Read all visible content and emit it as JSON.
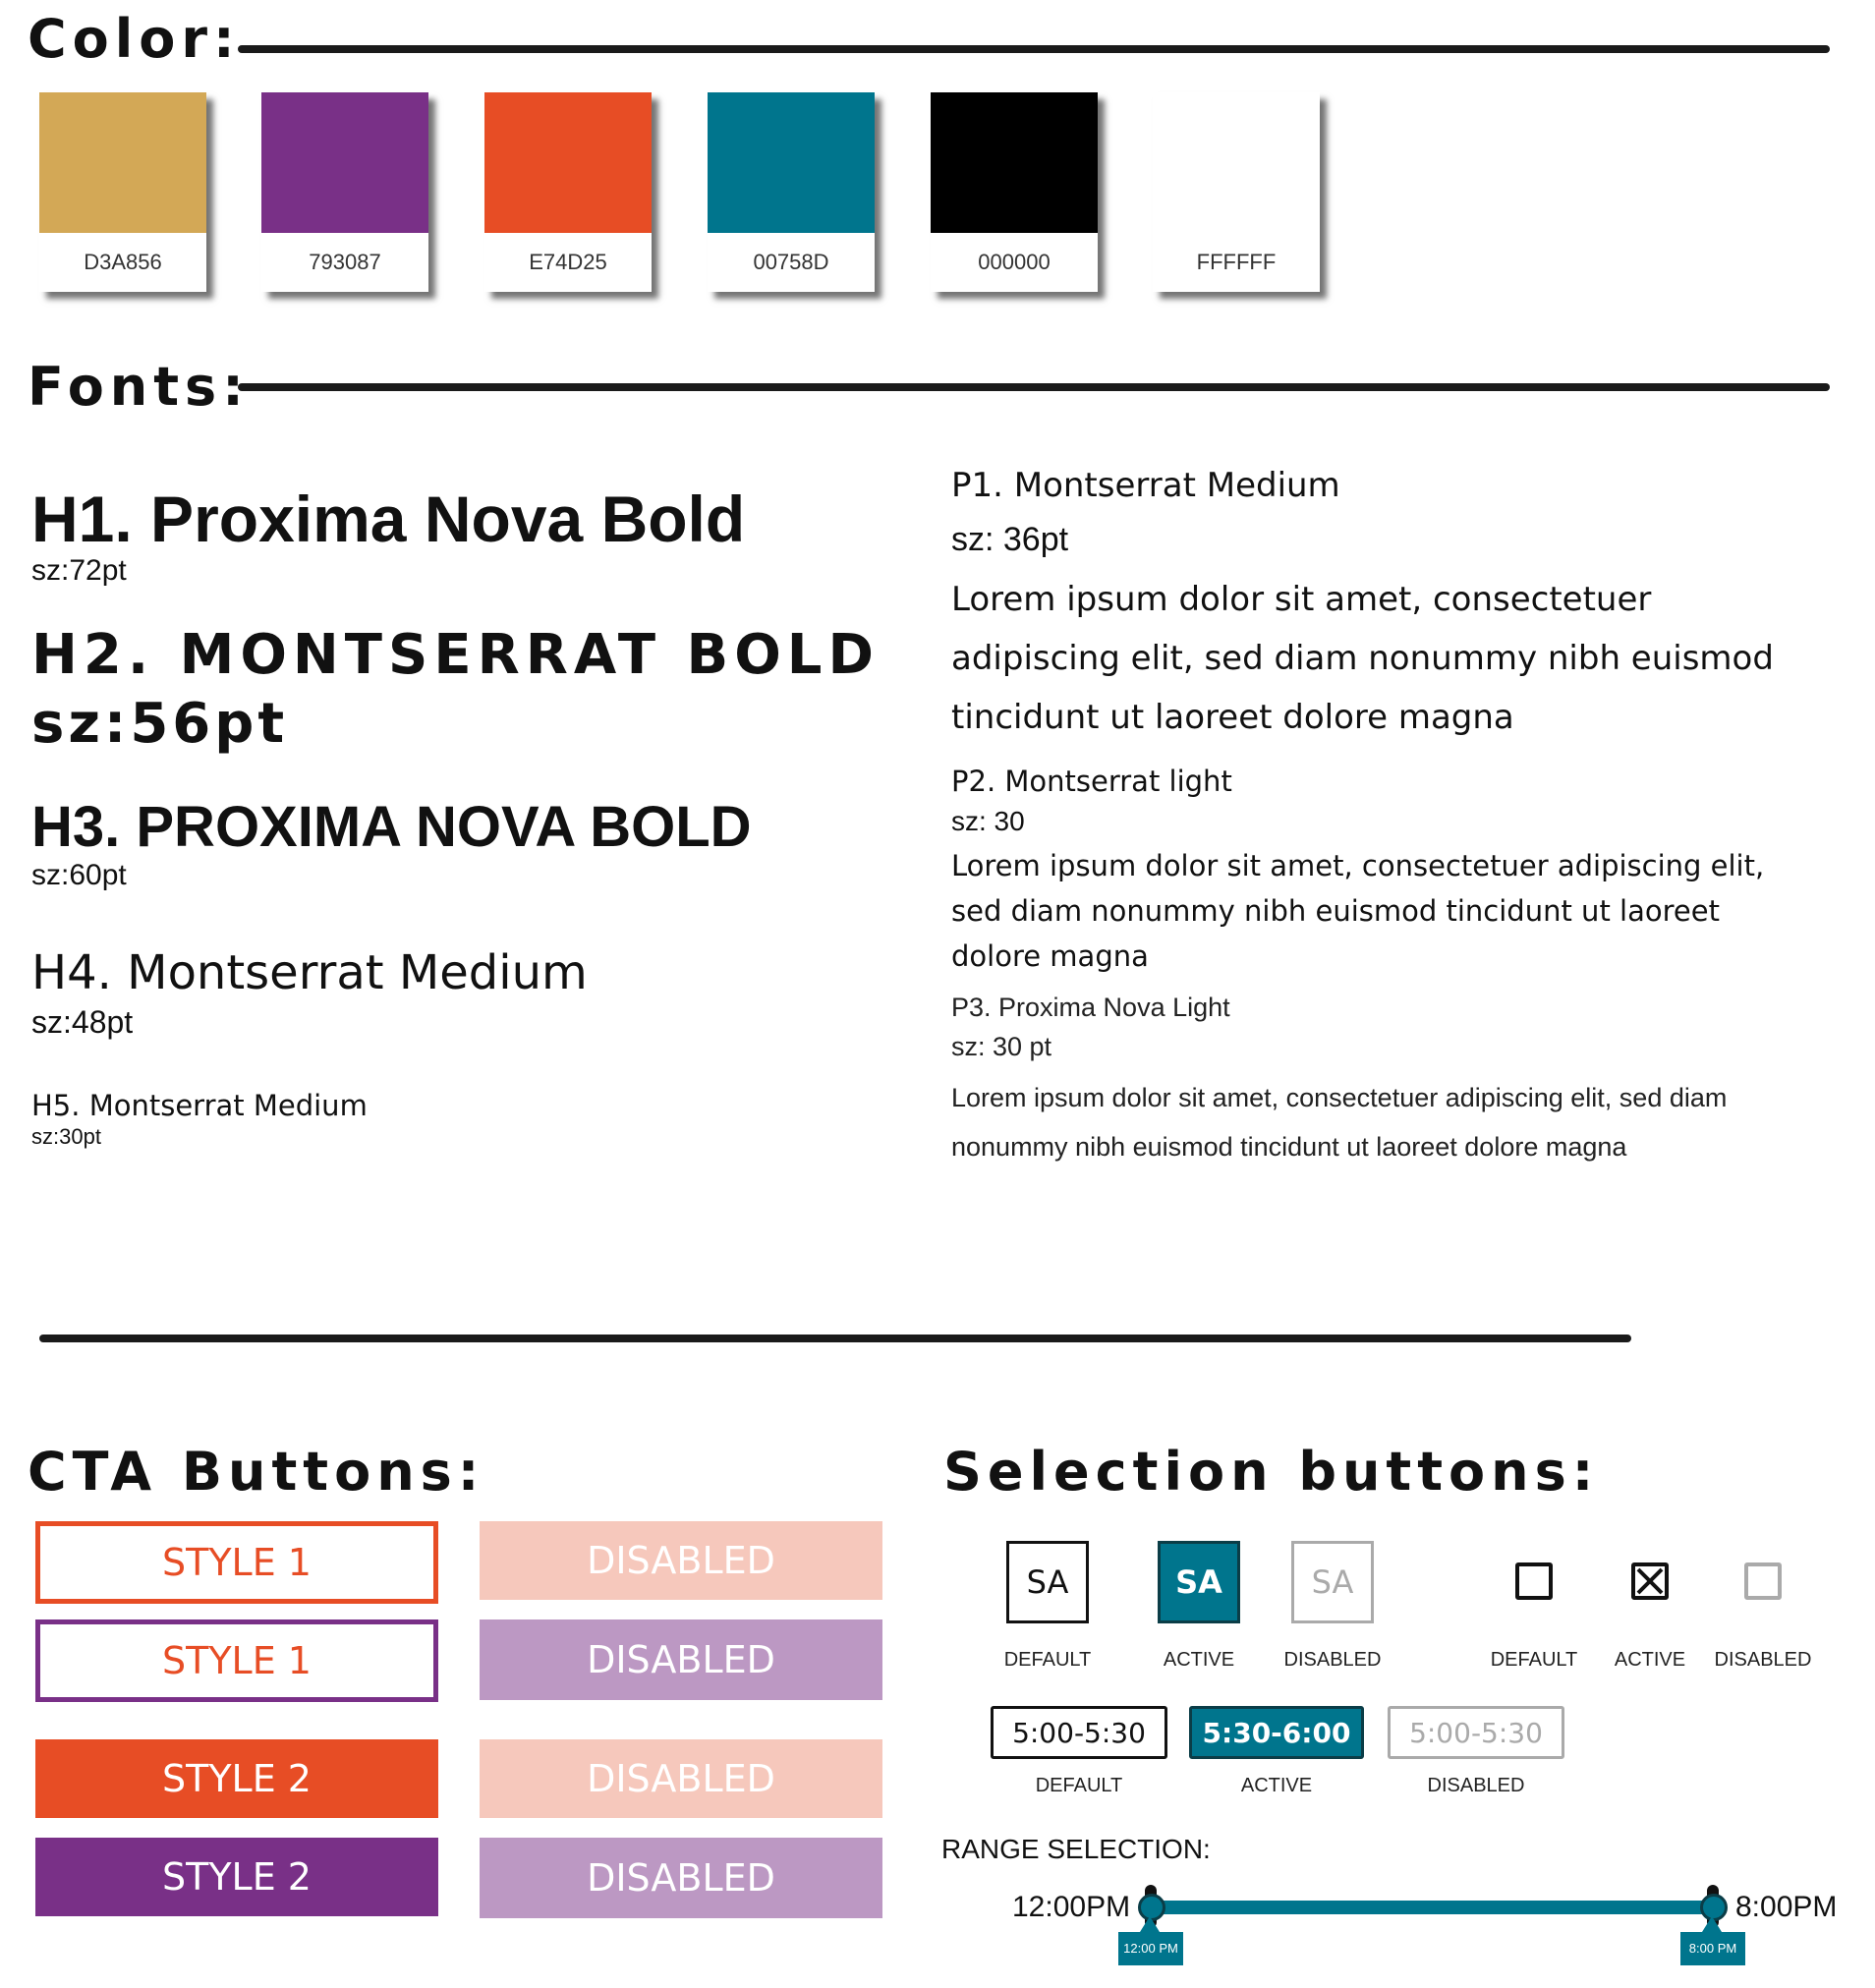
{
  "sections": {
    "color": "Color:",
    "fonts": "Fonts:",
    "cta": "CTA Buttons:",
    "selection": "Selection buttons:"
  },
  "colors": [
    {
      "hex": "D3A856",
      "color": "#D3A856"
    },
    {
      "hex": "793087",
      "color": "#793087"
    },
    {
      "hex": "E74D25",
      "color": "#E74D25"
    },
    {
      "hex": "00758D",
      "color": "#00758D"
    },
    {
      "hex": "000000",
      "color": "#000000"
    },
    {
      "hex": "FFFFFF",
      "color": "#FFFFFF"
    }
  ],
  "fonts": {
    "h1": {
      "name": "H1. Proxima Nova Bold",
      "size": "sz:72pt"
    },
    "h2": {
      "name": "H2. MONTSERRAT BOLD",
      "size": "sz:56pt"
    },
    "h3": {
      "name": "H3. PROXIMA NOVA BOLD",
      "size": "sz:60pt"
    },
    "h4": {
      "name": "H4. Montserrat Medium",
      "size": "sz:48pt"
    },
    "h5": {
      "name": "H5. Montserrat Medium",
      "size": "sz:30pt"
    },
    "p1": {
      "name": "P1. Montserrat Medium",
      "size": "sz: 36pt",
      "lines": [
        "Lorem ipsum dolor sit amet, consectetuer",
        "adipiscing elit, sed diam nonummy nibh euismod",
        "tincidunt ut laoreet dolore magna"
      ]
    },
    "p2": {
      "name": "P2. Montserrat light",
      "size": "sz: 30",
      "lines": [
        "Lorem ipsum dolor sit amet, consectetuer adipiscing elit,",
        "sed diam nonummy nibh euismod tincidunt ut laoreet",
        "dolore magna"
      ]
    },
    "p3": {
      "name": "P3. Proxima Nova Light",
      "size": "sz: 30 pt",
      "lines": [
        "Lorem ipsum dolor sit amet, consectetuer adipiscing elit, sed diam",
        "nonummy nibh euismod tincidunt ut laoreet dolore magna"
      ]
    }
  },
  "cta_buttons": {
    "style1_orange": "STYLE 1",
    "style1_purple": "STYLE 1",
    "style2_orange": "STYLE 2",
    "style2_purple": "STYLE 2",
    "disabled": "DISABLED"
  },
  "selection": {
    "sa_label": "SA",
    "states": {
      "default": "DEFAULT",
      "active": "ACTIVE",
      "disabled": "DISABLED"
    },
    "time_default": "5:00-5:30",
    "time_active": "5:30-6:00",
    "time_disabled": "5:00-5:30",
    "range_title": "RANGE SELECTION:",
    "range_start": "12:00PM",
    "range_end": "8:00PM",
    "range_start_tip": "12:00 PM",
    "range_end_tip": "8:00 PM"
  },
  "accent_colors": {
    "orange": "#E74D25",
    "purple": "#793087",
    "teal": "#00758D"
  }
}
